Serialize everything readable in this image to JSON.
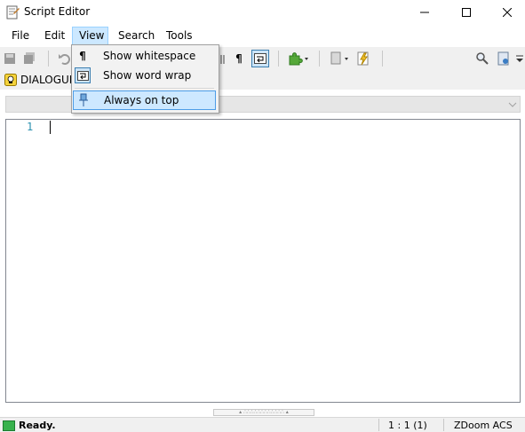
{
  "window": {
    "title": "Script Editor",
    "icon": "script-icon",
    "controls": {
      "minimize": "—",
      "maximize": "☐",
      "close": "✕"
    }
  },
  "menu": {
    "file": "File",
    "edit": "Edit",
    "view": "View",
    "search": "Search",
    "tools": "Tools"
  },
  "view_menu": {
    "items": [
      {
        "label": "Show whitespace",
        "icon": "pilcrow-icon"
      },
      {
        "label": "Show word wrap",
        "icon": "word-wrap-icon"
      },
      {
        "label": "Always on top",
        "icon": "pin-icon"
      }
    ]
  },
  "toolbar": {
    "pilcrow": "¶"
  },
  "document_tab": {
    "label": "DIALOGUE"
  },
  "editor": {
    "line_number": "1"
  },
  "status": {
    "text": "Ready.",
    "position": "1 : 1 (1)",
    "language": "ZDoom ACS"
  },
  "colors": {
    "accent": "#0078d7",
    "line_number": "#2b91af",
    "status_ok": "#37b24d",
    "menu_highlight": "#cde8ff"
  }
}
